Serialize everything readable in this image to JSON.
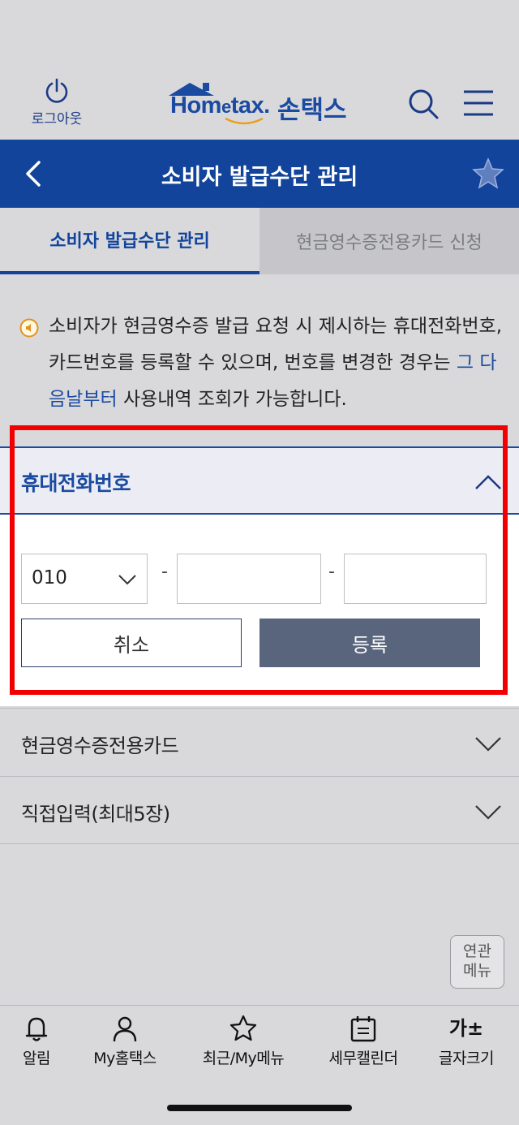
{
  "header": {
    "logout_label": "로그아웃",
    "logo_en_1": "Hom",
    "logo_en_e": "e",
    "logo_en_2": "tax.",
    "logo_kor": "손택스"
  },
  "title_bar": {
    "title": "소비자 발급수단 관리"
  },
  "tabs": [
    {
      "label": "소비자 발급수단 관리",
      "active": true
    },
    {
      "label": "현금영수증전용카드 신청",
      "active": false
    }
  ],
  "notice": {
    "text_1": "소비자가 현금영수증 발급 요청 시 제시하는 휴대전화번호, 카드번호를 등록할 수 있으며, 번호를 변경한 경우는 ",
    "text_highlight": "그 다음날부터",
    "text_2": " 사용내역 조회가 가능합니다."
  },
  "phone_section": {
    "title": "휴대전화번호",
    "prefix_value": "010",
    "separator": "-",
    "middle_value": "",
    "last_value": "",
    "cancel_label": "취소",
    "submit_label": "등록"
  },
  "sections": [
    {
      "label": "현금영수증전용카드"
    },
    {
      "label": "직접입력(최대5장)"
    }
  ],
  "related_menu": {
    "line1": "연관",
    "line2": "메뉴"
  },
  "bottom_nav": [
    {
      "label": "알림",
      "icon": "bell-icon"
    },
    {
      "label": "My홈택스",
      "icon": "person-icon"
    },
    {
      "label": "최근/My메뉴",
      "icon": "star-icon"
    },
    {
      "label": "세무캘린더",
      "icon": "calendar-icon"
    },
    {
      "label": "글자크기",
      "icon": "font-size-icon",
      "glyph": "가±"
    }
  ],
  "colors": {
    "primary": "#13449b",
    "highlight_border": "#f00000",
    "submit_button": "#59647d"
  }
}
